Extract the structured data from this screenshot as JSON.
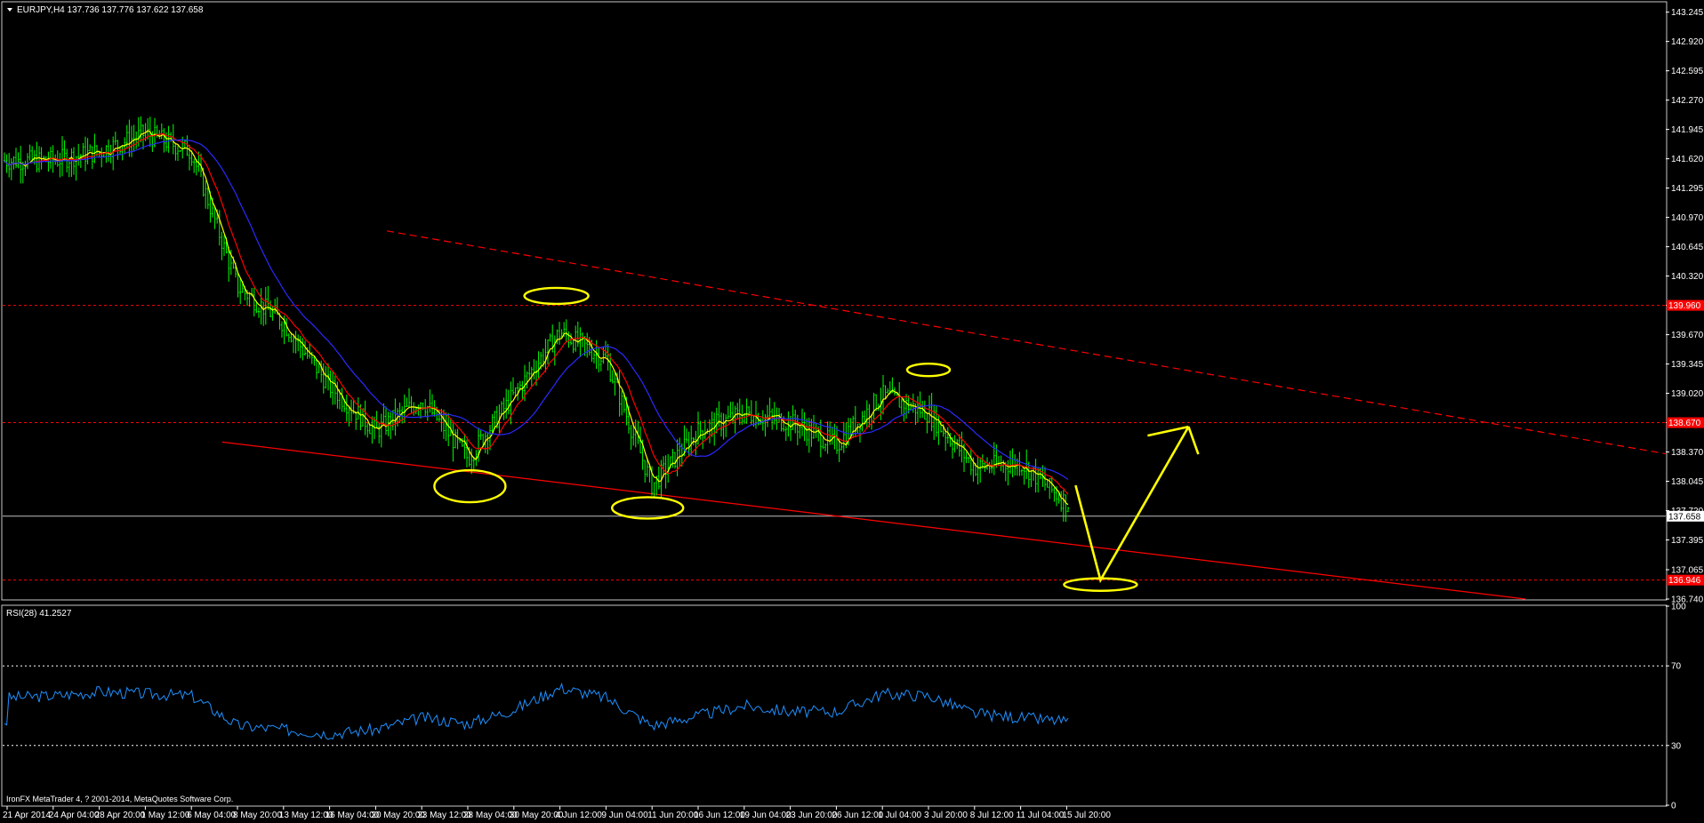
{
  "header": {
    "symbol_line": "EURJPY,H4  137.736 137.776 137.622 137.658"
  },
  "footer": {
    "copyright": "IronFX MetaTrader 4, ? 2001-2014, MetaQuotes Software Corp."
  },
  "colors": {
    "background": "#000000",
    "grid": "#ffffff",
    "candles": "#00ff00",
    "ma_fast": "#ffff00",
    "ma_mid": "#ff0000",
    "ma_slow": "#2a2aff",
    "trend_lines": "#ff0000",
    "annotations": "#ffff00",
    "rsi_line": "#1e90ff",
    "current_price_line": "#c0c0c0"
  },
  "chart_data": [
    {
      "type": "candlestick",
      "title": "EURJPY,H4",
      "ohlc_last": {
        "open": 137.736,
        "high": 137.776,
        "low": 137.622,
        "close": 137.658
      },
      "ylim": [
        136.74,
        143.35
      ],
      "y_ticks": [
        "143.245",
        "142.920",
        "142.595",
        "142.270",
        "141.945",
        "141.620",
        "141.295",
        "140.970",
        "140.645",
        "140.320",
        "139.995",
        "139.670",
        "139.345",
        "139.020",
        "138.695",
        "138.370",
        "138.045",
        "137.720",
        "137.395",
        "137.065",
        "136.740"
      ],
      "x_ticks": [
        "21 Apr 2014",
        "24 Apr 04:00",
        "28 Apr 20:00",
        "1 May 12:00",
        "6 May 04:00",
        "8 May 20:00",
        "13 May 12:00",
        "16 May 04:00",
        "20 May 20:00",
        "23 May 12:00",
        "28 May 04:00",
        "30 May 20:00",
        "4 Jun 12:00",
        "9 Jun 04:00",
        "11 Jun 20:00",
        "16 Jun 12:00",
        "19 Jun 04:00",
        "23 Jun 20:00",
        "26 Jun 12:00",
        "1 Jul 04:00",
        "3 Jul 20:00",
        "8 Jul 12:00",
        "11 Jul 04:00",
        "15 Jul 20:00"
      ],
      "price_path": [
        [
          "21 Apr 2014",
          141.6
        ],
        [
          "24 Apr 04:00",
          141.6
        ],
        [
          "28 Apr 20:00",
          141.7
        ],
        [
          "1 May 12:00",
          141.9
        ],
        [
          "6 May 04:00",
          141.7
        ],
        [
          "8 May 20:00",
          140.2
        ],
        [
          "13 May 12:00",
          139.8
        ],
        [
          "16 May 04:00",
          139.1
        ],
        [
          "20 May 20:00",
          138.6
        ],
        [
          "23 May 12:00",
          138.95
        ],
        [
          "28 May 04:00",
          138.3
        ],
        [
          "30 May 20:00",
          139.0
        ],
        [
          "4 Jun 12:00",
          139.7
        ],
        [
          "9 Jun 04:00",
          139.4
        ],
        [
          "11 Jun 20:00",
          138.0
        ],
        [
          "16 Jun 12:00",
          138.6
        ],
        [
          "19 Jun 04:00",
          138.8
        ],
        [
          "23 Jun 20:00",
          138.7
        ],
        [
          "26 Jun 12:00",
          138.45
        ],
        [
          "1 Jul 04:00",
          139.0
        ],
        [
          "3 Jul 20:00",
          138.8
        ],
        [
          "8 Jul 12:00",
          138.2
        ],
        [
          "11 Jul 04:00",
          138.25
        ],
        [
          "15 Jul 20:00",
          137.8
        ]
      ],
      "horizontal_levels": [
        {
          "value": 139.995,
          "label": "139.960",
          "style": "dashed"
        },
        {
          "value": 138.695,
          "label": "138.670",
          "style": "dashed"
        },
        {
          "value": 137.658,
          "label": "137.658",
          "style": "solid"
        },
        {
          "value": 136.95,
          "label": "136.946",
          "style": "dashed"
        }
      ],
      "trend_lines": [
        {
          "from": [
            "8 May 20:00",
            140.82
          ],
          "to": [
            "15 Jul 20:00",
            138.35
          ],
          "style": "dashed"
        },
        {
          "from": [
            "6 May 04:00",
            138.48
          ],
          "to": [
            "15 Jul 20:00",
            136.74
          ],
          "style": "solid"
        }
      ],
      "annotation_ellipses": [
        [
          "20 May 20:00",
          137.99
        ],
        [
          "4 Jun 12:00",
          140.1
        ],
        [
          "11 Jun 20:00",
          137.75
        ],
        [
          "3 Jul 20:00",
          139.28
        ],
        [
          "15 Jul 20:00",
          136.9
        ]
      ],
      "forecast_arrow": [
        [
          "15 Jul 20:00",
          138.0
        ],
        [
          "15 Jul 20:00",
          136.95
        ],
        [
          "15 Jul 20:00",
          138.65
        ]
      ]
    },
    {
      "type": "line",
      "title": "RSI(28) 41.2527",
      "ylim": [
        0,
        100
      ],
      "y_ticks": [
        "100",
        "70",
        "30",
        "0"
      ],
      "levels": [
        70,
        30
      ],
      "x": [
        "21 Apr 2014",
        "24 Apr 04:00",
        "28 Apr 20:00",
        "1 May 12:00",
        "6 May 04:00",
        "8 May 20:00",
        "13 May 12:00",
        "16 May 04:00",
        "20 May 20:00",
        "23 May 12:00",
        "28 May 04:00",
        "30 May 20:00",
        "4 Jun 12:00",
        "9 Jun 04:00",
        "11 Jun 20:00",
        "16 Jun 12:00",
        "19 Jun 04:00",
        "23 Jun 20:00",
        "26 Jun 12:00",
        "1 Jul 04:00",
        "3 Jul 20:00",
        "8 Jul 12:00",
        "11 Jul 04:00",
        "15 Jul 20:00"
      ],
      "values": [
        54,
        55,
        57,
        56,
        55,
        40,
        38,
        36,
        38,
        44,
        41,
        48,
        59,
        54,
        40,
        45,
        50,
        47,
        47,
        56,
        55,
        46,
        44,
        42
      ]
    }
  ]
}
